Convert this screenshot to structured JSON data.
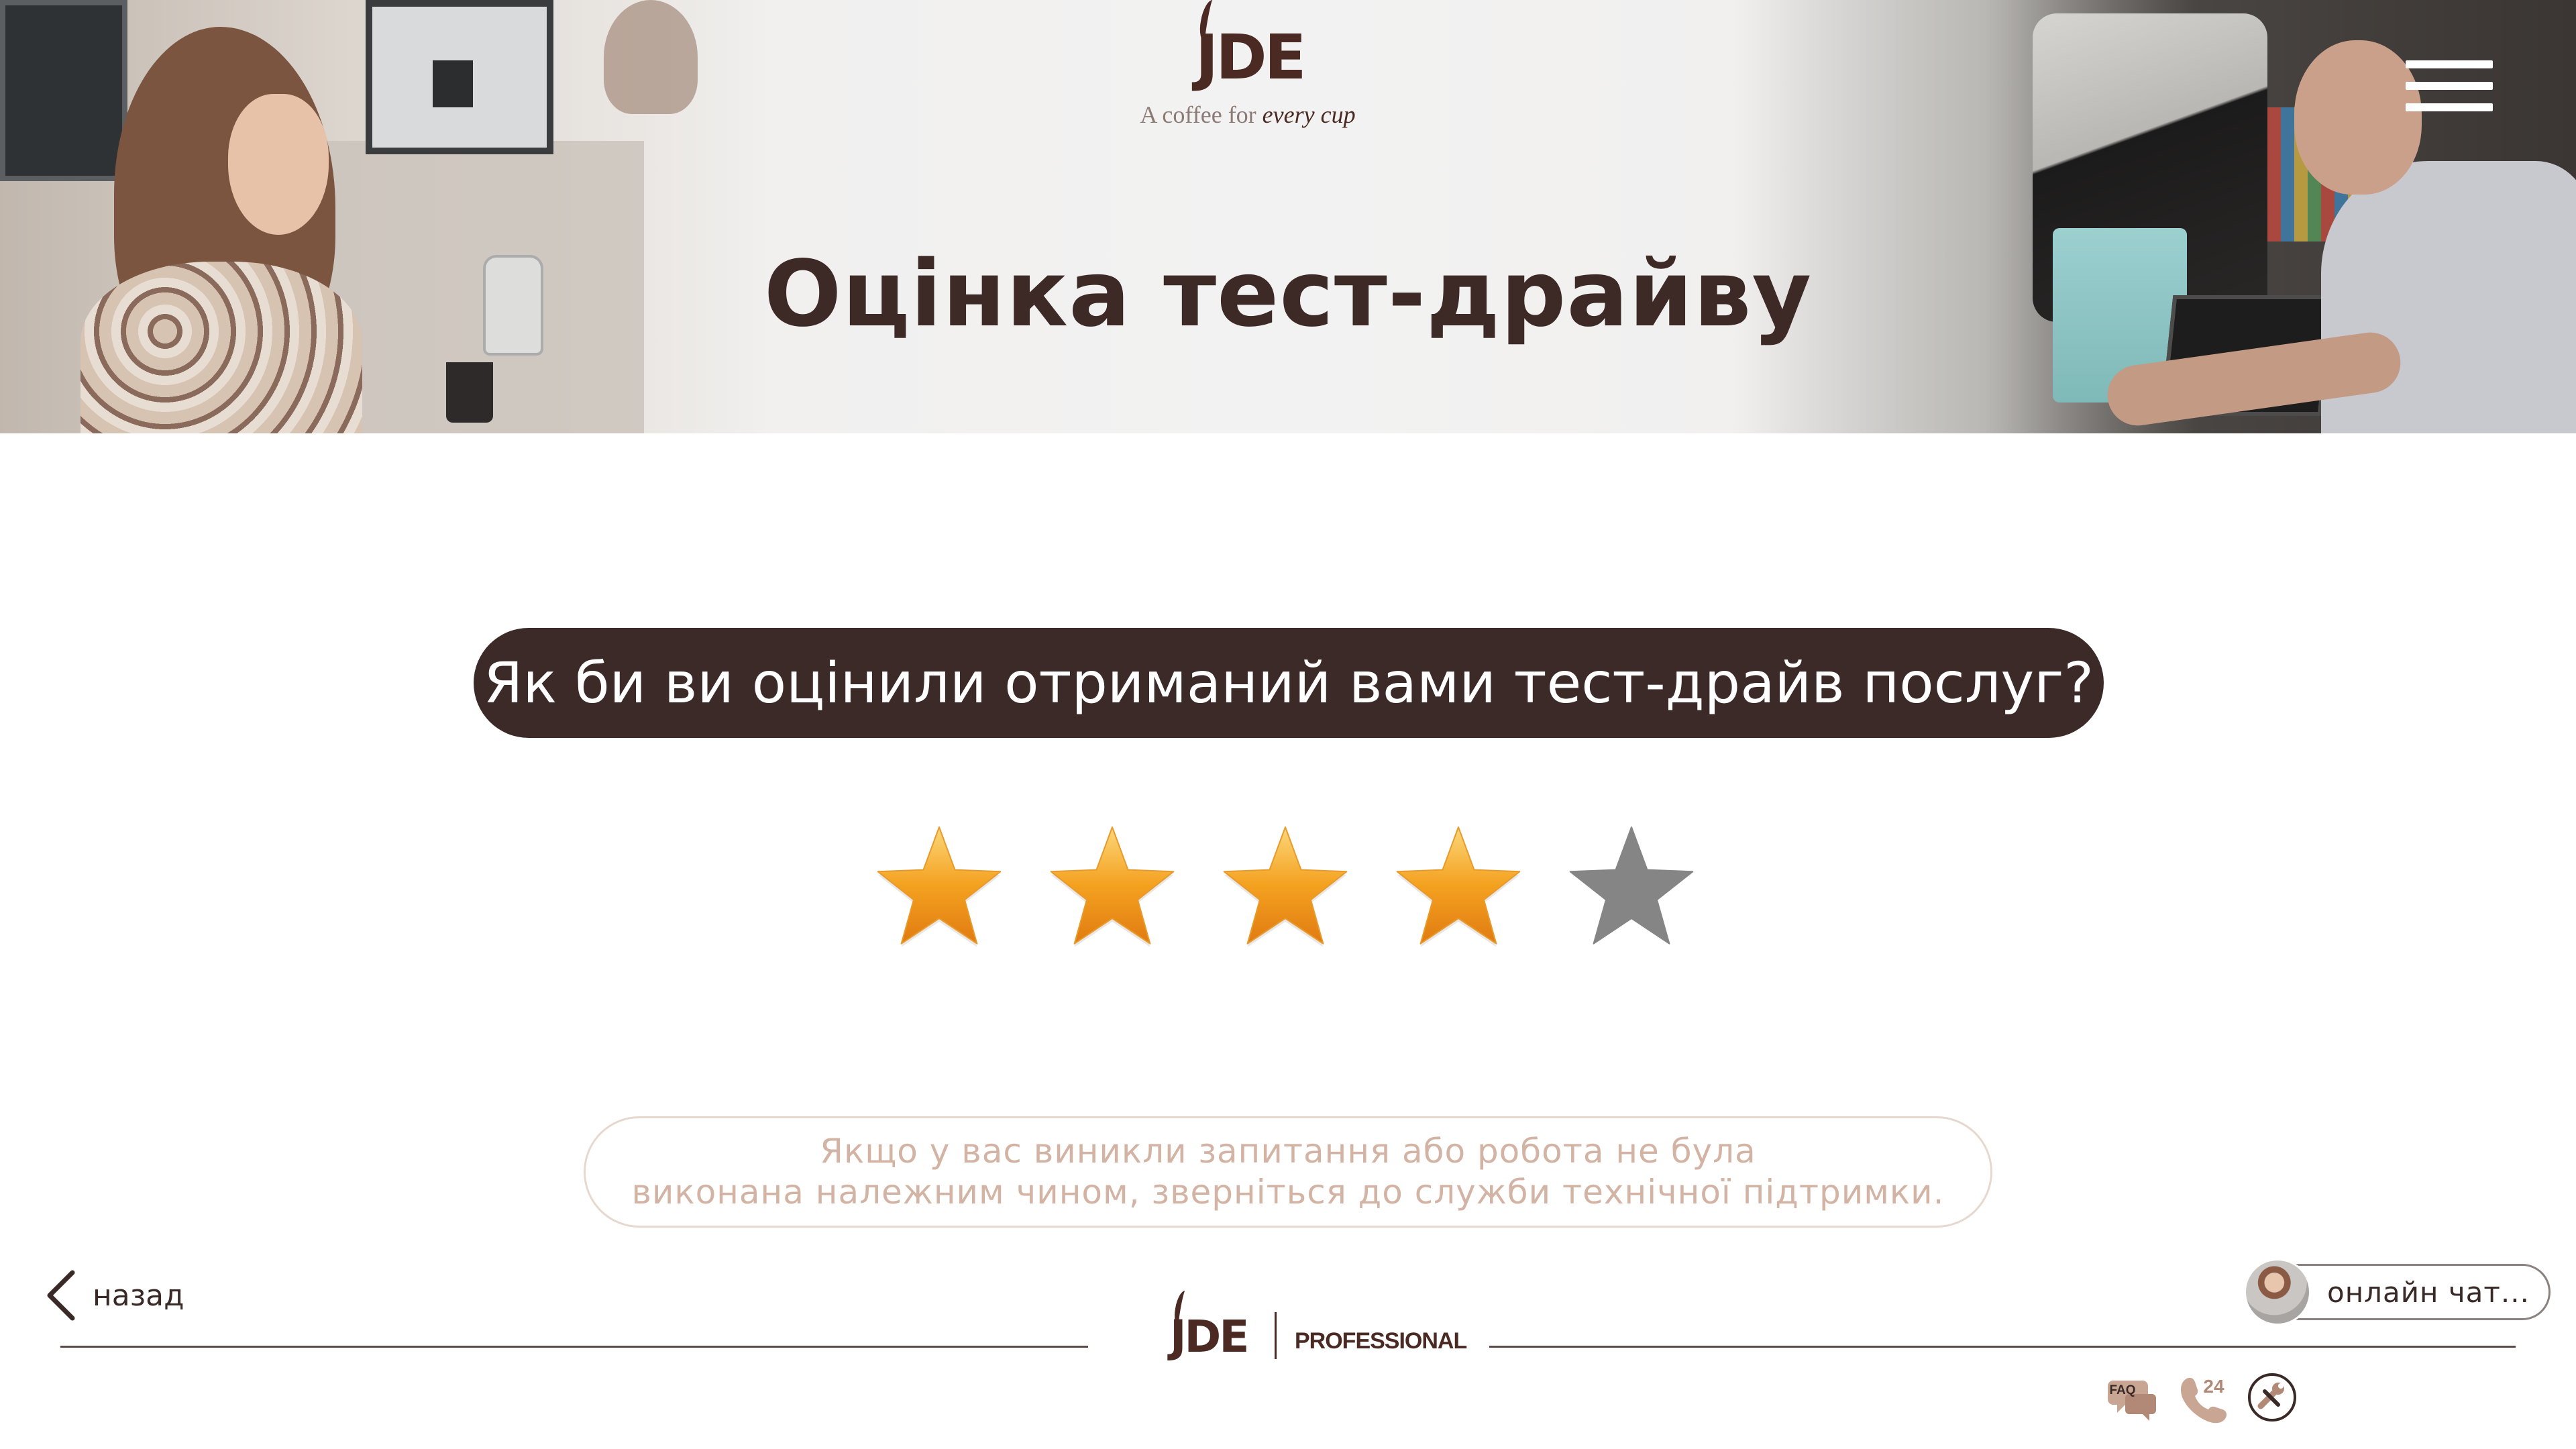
{
  "header": {
    "logo_text": "JDE",
    "tagline_prefix": "A coffee for ",
    "tagline_emphasis": "every cup",
    "title": "Оцінка тест-драйву",
    "menu_icon": "hamburger-menu-icon"
  },
  "rating": {
    "question": "Як би ви оцінили отриманий вами тест-драйв послуг?",
    "max_stars": 5,
    "value": 4,
    "filled_color": "#f4a11f",
    "empty_color": "#858585"
  },
  "support_note": {
    "line1": "Якщо у вас виникли запитання або робота не була",
    "line2": "виконана належним чином, зверніться до служби технічної підтримки."
  },
  "footer": {
    "back_label": "назад",
    "back_icon": "chevron-left-icon",
    "logo_text": "JDE",
    "logo_suffix": "PROFESSIONAL",
    "chat_label": "онлайн чат...",
    "icons": [
      {
        "name": "faq-icon",
        "label": "FAQ"
      },
      {
        "name": "phone-24-icon",
        "label": "24"
      },
      {
        "name": "wrench-service-icon",
        "label": ""
      }
    ]
  },
  "colors": {
    "brand_brown": "#3b2a28",
    "accent_star": "#f4a11f",
    "muted_text": "#d2b3a4"
  }
}
